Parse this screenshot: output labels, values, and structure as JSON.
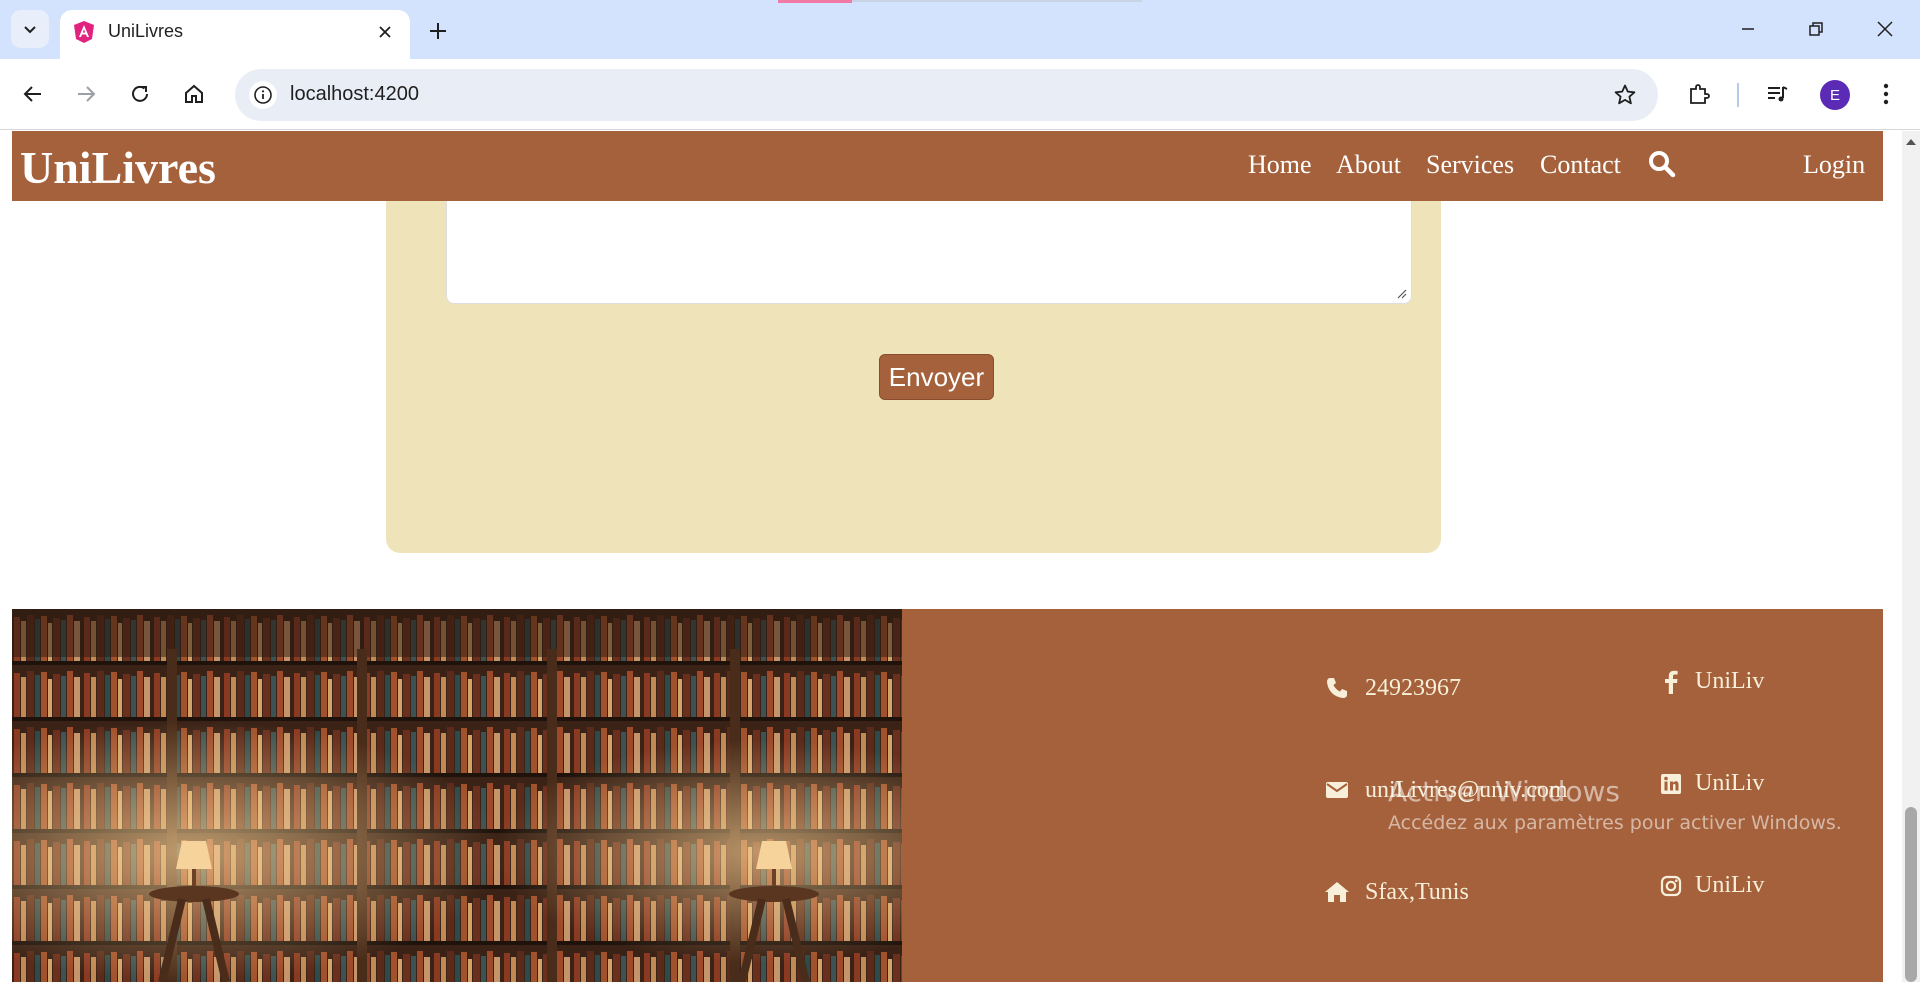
{
  "browser": {
    "tab_title": "UniLivres",
    "url": "localhost:4200",
    "profile_initial": "E"
  },
  "navbar": {
    "brand": "UniLivres",
    "links": [
      "Home",
      "About",
      "Services",
      "Contact"
    ],
    "login": "Login"
  },
  "form": {
    "submit_label": "Envoyer"
  },
  "footer": {
    "contact": {
      "phone": "24923967",
      "email": "uniLivres@univ.com",
      "address": "Sfax,Tunis"
    },
    "social": {
      "facebook": "UniLiv",
      "linkedin": "UniLiv",
      "instagram": "UniLiv"
    }
  },
  "watermark": {
    "title": "Activer Windows",
    "subtitle": "Accédez aux paramètres pour activer Windows."
  },
  "colors": {
    "accent": "#a5613b",
    "form_bg": "#eee3b9",
    "chrome_bg": "#d3e3fd"
  }
}
